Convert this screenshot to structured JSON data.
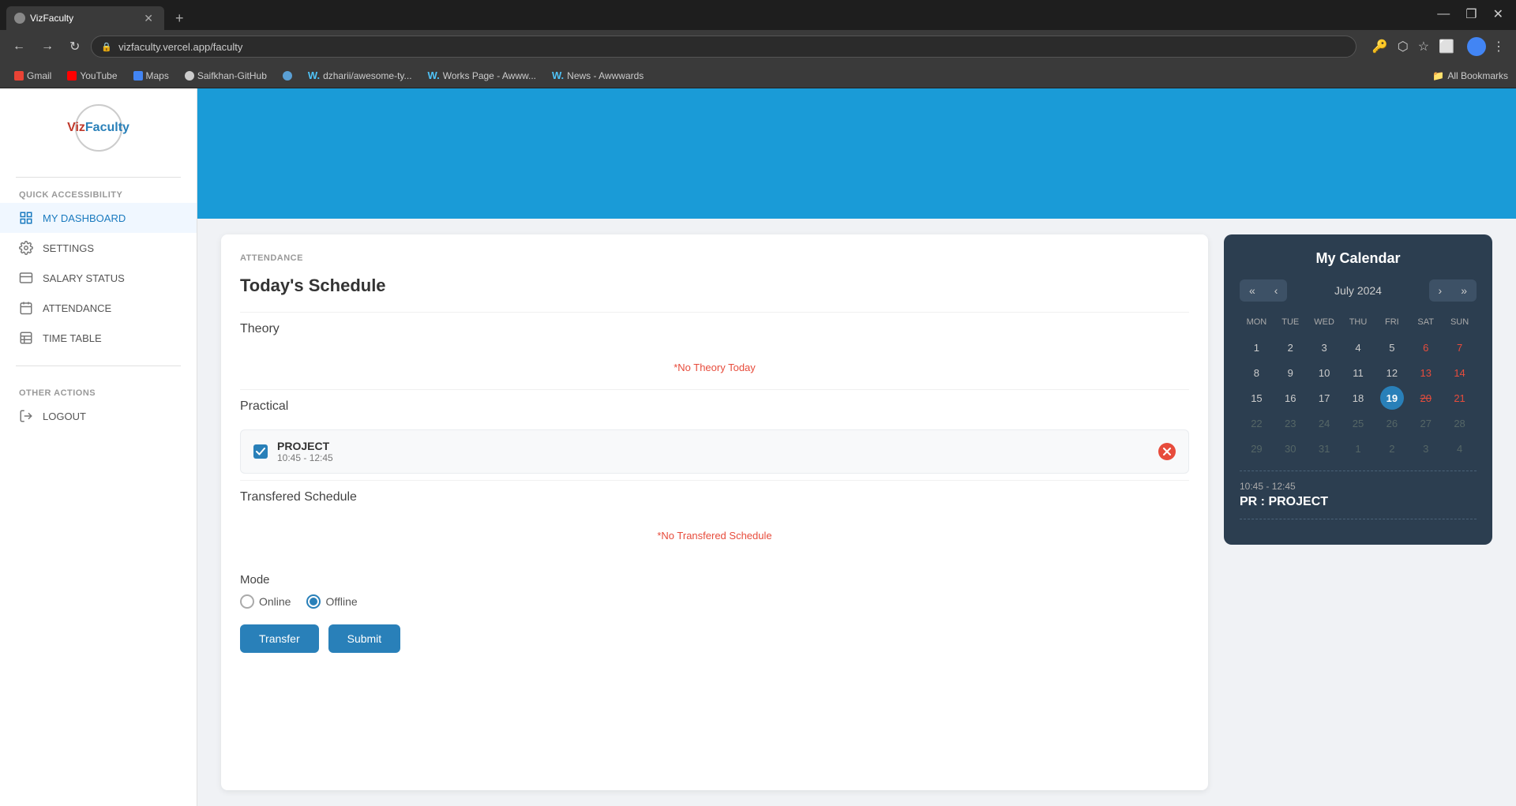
{
  "browser": {
    "tab_title": "VizFaculty",
    "url": "vizfaculty.vercel.app/faculty",
    "tab_new_label": "+",
    "window_minimize": "—",
    "window_restore": "❐",
    "window_close": "✕"
  },
  "bookmarks": [
    {
      "label": "Gmail",
      "type": "gmail"
    },
    {
      "label": "YouTube",
      "type": "youtube"
    },
    {
      "label": "Maps",
      "type": "maps"
    },
    {
      "label": "Saifkhan-GitHub",
      "type": "github"
    },
    {
      "label": "",
      "type": "globe"
    },
    {
      "label": "dzharii/awesome-ty...",
      "type": "w"
    },
    {
      "label": "Works Page - Awww...",
      "type": "w"
    },
    {
      "label": "News - Awwwards",
      "type": "w"
    }
  ],
  "all_bookmarks_label": "All Bookmarks",
  "sidebar": {
    "logo_text_viz": "Viz",
    "logo_text_faculty": "Faculty",
    "quick_accessibility_label": "QUICK ACCESSIBILITY",
    "items": [
      {
        "label": "MY DASHBOARD",
        "active": true,
        "icon": "dashboard"
      },
      {
        "label": "SETTINGS",
        "active": false,
        "icon": "settings"
      },
      {
        "label": "SALARY STATUS",
        "active": false,
        "icon": "salary"
      },
      {
        "label": "ATTENDANCE",
        "active": false,
        "icon": "attendance"
      },
      {
        "label": "TIME TABLE",
        "active": false,
        "icon": "timetable"
      }
    ],
    "other_actions_label": "OTHER ACTIONS",
    "logout_label": "LOGOUT"
  },
  "attendance": {
    "section_label": "ATTENDANCE",
    "page_title": "Today's Schedule",
    "theory_label": "Theory",
    "no_theory_message": "*No Theory Today",
    "practical_label": "Practical",
    "practical_item": {
      "name": "PROJECT",
      "time": "10:45 - 12:45"
    },
    "transferred_label": "Transfered Schedule",
    "no_transferred_message": "*No Transfered Schedule",
    "mode_label": "Mode",
    "mode_options": [
      {
        "label": "Online",
        "selected": false
      },
      {
        "label": "Offline",
        "selected": true
      }
    ],
    "transfer_btn": "Transfer",
    "submit_btn": "Submit"
  },
  "calendar": {
    "title": "My Calendar",
    "month_year": "July 2024",
    "prev_prev_label": "«",
    "prev_label": "‹",
    "next_label": "›",
    "next_next_label": "»",
    "days": [
      "MON",
      "TUE",
      "WED",
      "THU",
      "FRI",
      "SAT",
      "SUN"
    ],
    "weeks": [
      [
        {
          "day": "1",
          "type": "normal"
        },
        {
          "day": "2",
          "type": "normal"
        },
        {
          "day": "3",
          "type": "normal"
        },
        {
          "day": "4",
          "type": "normal"
        },
        {
          "day": "5",
          "type": "normal"
        },
        {
          "day": "6",
          "type": "weekend"
        },
        {
          "day": "7",
          "type": "weekend"
        }
      ],
      [
        {
          "day": "8",
          "type": "normal"
        },
        {
          "day": "9",
          "type": "normal"
        },
        {
          "day": "10",
          "type": "normal"
        },
        {
          "day": "11",
          "type": "normal"
        },
        {
          "day": "12",
          "type": "normal"
        },
        {
          "day": "13",
          "type": "weekend"
        },
        {
          "day": "14",
          "type": "weekend"
        }
      ],
      [
        {
          "day": "15",
          "type": "normal"
        },
        {
          "day": "16",
          "type": "normal"
        },
        {
          "day": "17",
          "type": "normal"
        },
        {
          "day": "18",
          "type": "normal"
        },
        {
          "day": "19",
          "type": "today"
        },
        {
          "day": "20",
          "type": "strikethrough weekend"
        },
        {
          "day": "21",
          "type": "weekend"
        }
      ],
      [
        {
          "day": "22",
          "type": "other-month"
        },
        {
          "day": "23",
          "type": "other-month"
        },
        {
          "day": "24",
          "type": "other-month"
        },
        {
          "day": "25",
          "type": "other-month"
        },
        {
          "day": "26",
          "type": "other-month"
        },
        {
          "day": "27",
          "type": "weekend other-month"
        },
        {
          "day": "28",
          "type": "weekend other-month"
        }
      ],
      [
        {
          "day": "29",
          "type": "other-month"
        },
        {
          "day": "30",
          "type": "other-month"
        },
        {
          "day": "31",
          "type": "other-month"
        },
        {
          "day": "1",
          "type": "other-month"
        },
        {
          "day": "2",
          "type": "other-month"
        },
        {
          "day": "3",
          "type": "other-month"
        },
        {
          "day": "4",
          "type": "other-month"
        }
      ]
    ],
    "event_time": "10:45 - 12:45",
    "event_title": "PR : PROJECT"
  }
}
